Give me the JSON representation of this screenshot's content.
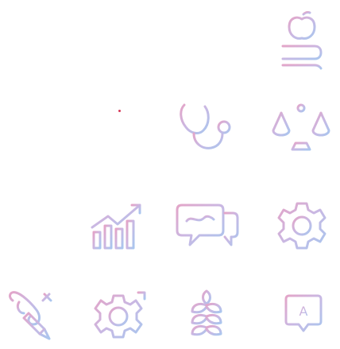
{
  "icons": [
    {
      "name": "apple-on-books-icon"
    },
    {
      "name": "stethoscope-icon"
    },
    {
      "name": "balance-scale-icon"
    },
    {
      "name": "growth-chart-icon"
    },
    {
      "name": "chat-bubbles-icon"
    },
    {
      "name": "settings-gear-icon"
    },
    {
      "name": "pencil-ribbon-icon"
    },
    {
      "name": "gears-icon"
    },
    {
      "name": "wheat-icon"
    },
    {
      "name": "translate-chat-icon"
    }
  ],
  "colors": {
    "gradient_start": "#e3a5c8",
    "gradient_mid": "#c9b8e3",
    "gradient_end": "#a9c6ee",
    "accent_dot": "#d63a5a",
    "background": "#ffffff"
  },
  "translate_letter": "A"
}
